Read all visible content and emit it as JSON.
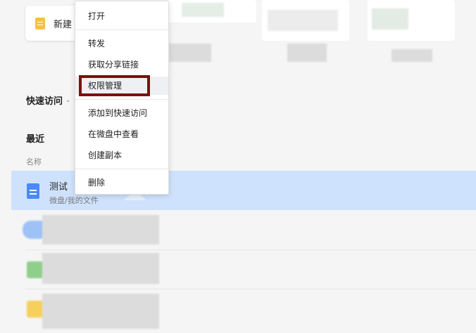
{
  "top_card": {
    "name": "新建",
    "icon": "yellow-document-icon"
  },
  "quick_access": {
    "label": "快速访问",
    "chevron": "⌄"
  },
  "recent": {
    "title": "最近",
    "column_header": "名称"
  },
  "selected_file": {
    "name": "测试",
    "path": "微盘/我的文件",
    "icon": "blue-document-icon"
  },
  "context_menu": {
    "items": [
      "打开",
      "转发",
      "获取分享链接",
      "权限管理",
      "添加到快速访问",
      "在微盘中查看",
      "创建副本",
      "删除"
    ],
    "hovered": "权限管理"
  },
  "colors": {
    "selection": "#cfe2fd",
    "highlight_border": "#7b1010",
    "doc_blue": "#4a8af4",
    "doc_yellow": "#f6c142"
  }
}
